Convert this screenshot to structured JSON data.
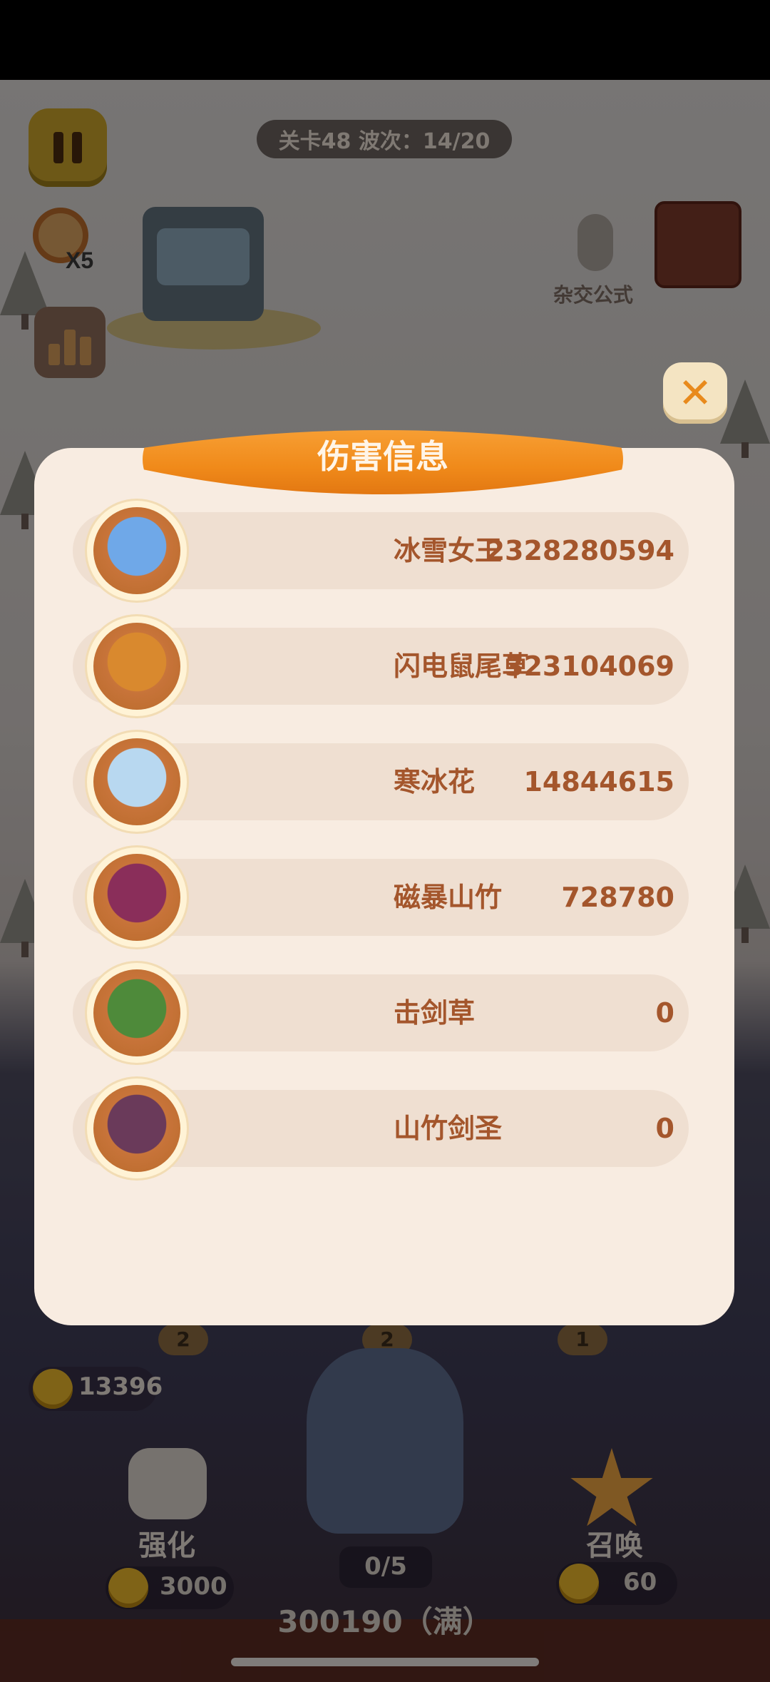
{
  "hud": {
    "level_wave": "关卡48 波次：14/20",
    "speed_label": "X5",
    "formula_label": "杂交公式",
    "coins": "13396",
    "strengthen_label": "强化",
    "strengthen_cost": "3000",
    "summon_label": "召唤",
    "summon_cost": "60",
    "progress": "0/5",
    "experience": "300190（满）",
    "badges": [
      "2",
      "2",
      "1"
    ]
  },
  "modal": {
    "title": "伤害信息",
    "close_icon": "close-icon",
    "rows": [
      {
        "name": "冰雪女王",
        "damage": "2328280594",
        "avatar_color": "#6fa8e8"
      },
      {
        "name": "闪电鼠尾草",
        "damage": "323104069",
        "avatar_color": "#d9892e"
      },
      {
        "name": "寒冰花",
        "damage": "14844615",
        "avatar_color": "#b8d8f0"
      },
      {
        "name": "磁暴山竹",
        "damage": "728780",
        "avatar_color": "#8a2e5a"
      },
      {
        "name": "击剑草",
        "damage": "0",
        "avatar_color": "#4e8a3a"
      },
      {
        "name": "山竹剑圣",
        "damage": "0",
        "avatar_color": "#6a3a5a"
      }
    ]
  },
  "colors": {
    "accent": "#f08a1a",
    "panel": "#f8ece1",
    "row": "#efdfd1",
    "text": "#a4562c"
  }
}
